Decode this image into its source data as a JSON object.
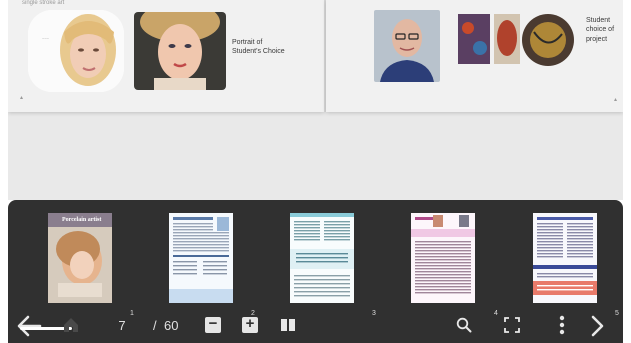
{
  "spread": {
    "top_left_text": "single stroke art",
    "left_caption": [
      "Portrait of",
      "Student's Choice"
    ],
    "right_caption": [
      "Student",
      "choice of",
      "project"
    ]
  },
  "thumbnails": {
    "page_numbers": [
      "1",
      "2",
      "3",
      "4",
      "5"
    ],
    "cover_title": "Porcelain artist"
  },
  "toolbar": {
    "current_page": "7",
    "separator": "/",
    "total_pages": "60",
    "icons": [
      "back-arrow-icon",
      "home-icon",
      "zoom-out-icon",
      "zoom-in-icon",
      "double-page-icon",
      "search-icon",
      "fullscreen-icon",
      "more-vert-icon",
      "next-arrow-icon"
    ]
  },
  "colors": {
    "panel": "#303030",
    "stage": "#e9e9e9",
    "icon": "#e8e8e8"
  }
}
